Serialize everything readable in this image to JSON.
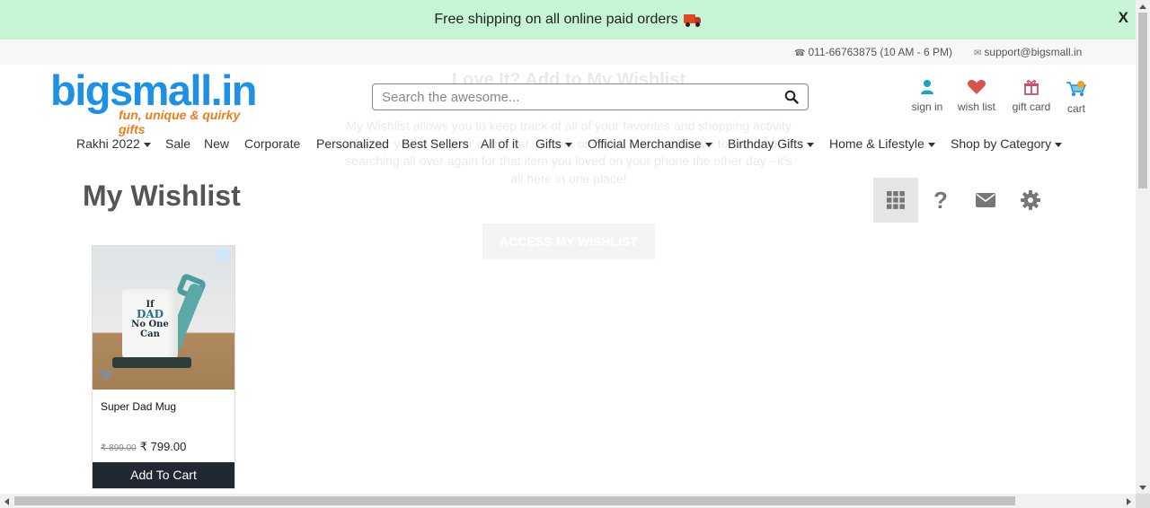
{
  "promo": {
    "text": "Free shipping on all online paid orders",
    "close": "X"
  },
  "contact": {
    "phone": "011-66763875 (10 AM - 6 PM)",
    "email": "support@bigsmall.in"
  },
  "overlay": {
    "title": "Love It? Add to My Wishlist",
    "body": "My Wishlist allows you to keep track of all of your favorites and shopping activity whether you're on your computer, phone, or tablet. You won't have to waste time searching all over again for that item you loved on your phone the other day - it's all here in one place!",
    "button": "ACCESS MY WISHLIST"
  },
  "logo": {
    "main": "bigsmall.in",
    "tagline": "fun, unique & quirky gifts"
  },
  "search": {
    "placeholder": "Search the awesome...",
    "value": ""
  },
  "header_links": {
    "signin": "sign in",
    "wishlist": "wish list",
    "giftcard": "gift card",
    "cart": "cart"
  },
  "nav": [
    {
      "label": "Rakhi 2022",
      "dropdown": true
    },
    {
      "label": "Sale",
      "dropdown": false
    },
    {
      "label": "New",
      "dropdown": false
    },
    {
      "label": "Corporate",
      "dropdown": false
    },
    {
      "label": "Personalized",
      "dropdown": false
    },
    {
      "label": "Best Sellers",
      "dropdown": false
    },
    {
      "label": "All of it",
      "dropdown": false
    },
    {
      "label": "Gifts",
      "dropdown": true
    },
    {
      "label": "Official Merchandise",
      "dropdown": true
    },
    {
      "label": "Birthday Gifts",
      "dropdown": true
    },
    {
      "label": "Home & Lifestyle",
      "dropdown": true
    },
    {
      "label": "Shop by Category",
      "dropdown": true
    }
  ],
  "page": {
    "title": "My Wishlist"
  },
  "tools": [
    "grid-icon",
    "help-icon",
    "mail-icon",
    "gear-icon"
  ],
  "product": {
    "name": "Super Dad Mug",
    "old_price": "₹ 899.00",
    "price": "₹ 799.00",
    "button": "Add To Cart",
    "mug_text": {
      "line1": "If",
      "line2": "DAD",
      "line3": "No One",
      "line4": "Can"
    }
  },
  "colors": {
    "promo_bg": "#c6f5d6",
    "brand_blue": "#1e90e6",
    "brand_orange": "#f07c1a",
    "user_icon": "#1aa3c7",
    "heart": "#d9534f",
    "button_dark": "#222831"
  }
}
